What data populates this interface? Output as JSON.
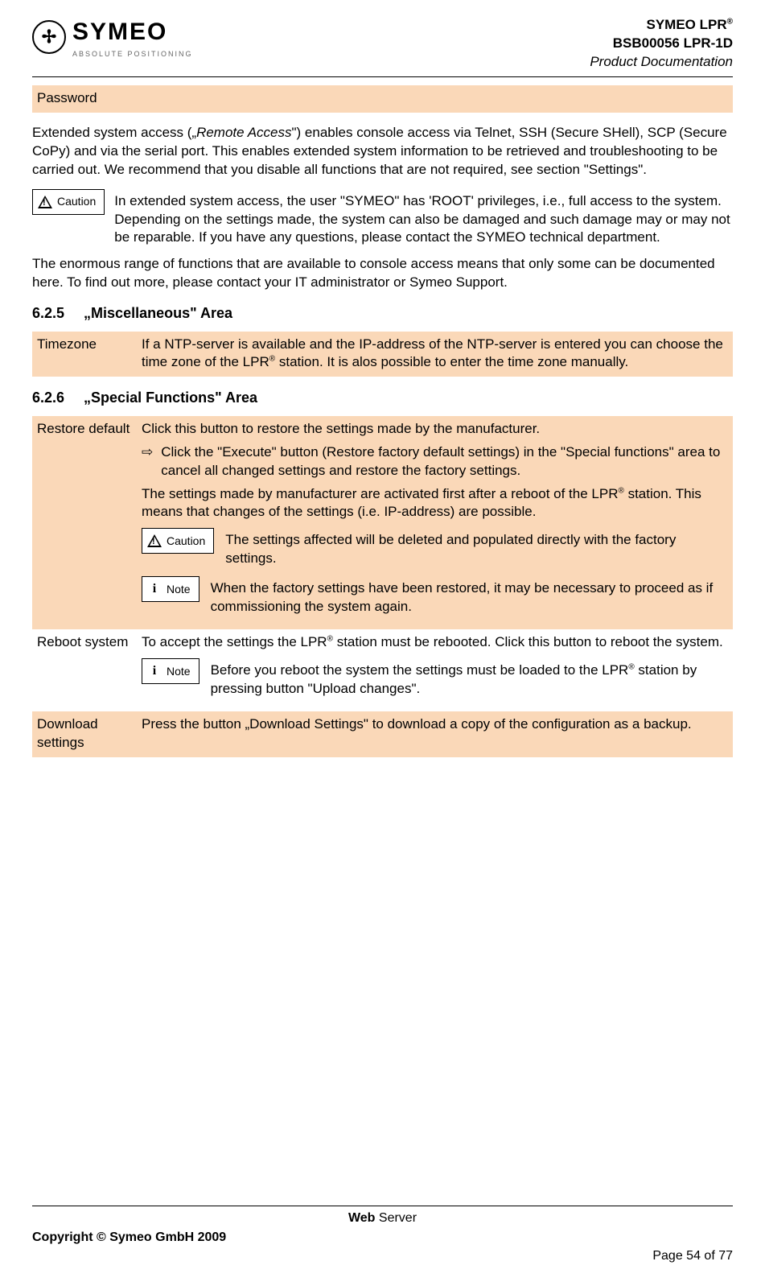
{
  "header": {
    "logo_name": "SYMEO",
    "logo_tag": "ABSOLUTE POSITIONING",
    "title1_pre": "SYMEO LPR",
    "title1_sup": "®",
    "title2": "BSB00056 LPR-1D",
    "title3": "Product Documentation"
  },
  "password_row": {
    "label": "Password",
    "value": ""
  },
  "para1_a": "Extended system access („",
  "para1_b": "Remote Access",
  "para1_c": "\") enables console access via Telnet, SSH (Secure SHell), SCP (Secure CoPy) and via the serial port. This enables extended system information to be retrieved and troubleshooting to be carried out. We recommend that you disable all functions that are not required, see section \"Settings\".",
  "caution_label": "Caution",
  "note_label": "Note",
  "caution1_text": "In extended system access, the user \"SYMEO\" has 'ROOT' privileges, i.e., full access to the system. Depending on the settings made, the system can also be damaged and such damage may or may not be reparable. If you have any questions, please contact the SYMEO technical department.",
  "para2": "The enormous range of functions that are available to console access means that only some can be documented here. To find out more, please contact your IT administrator or Symeo Support.",
  "sec625_no": "6.2.5",
  "sec625_title": "„Miscellaneous\" Area",
  "timezone": {
    "label": "Timezone",
    "text_a": "If a NTP-server is available and the IP-address of the NTP-server is entered you can choose the time zone of the LPR",
    "text_b": " station. It is alos possible to enter the time zone manually."
  },
  "sec626_no": "6.2.6",
  "sec626_title": "„Special Functions\" Area",
  "restore": {
    "label": "Restore default",
    "p1": "Click this button to restore the settings made by the manufacturer.",
    "bullet": "Click the \"Execute\" button (Restore factory default settings) in the \"Special functions\" area to cancel all changed settings and restore the factory settings.",
    "p2_a": "The settings made by manufacturer are activated first after a reboot of the LPR",
    "p2_b": " station. This means that changes of the settings (i.e. IP-address) are possible.",
    "caution_text": "The settings affected will be deleted and populated directly with the factory settings.",
    "note_text": "When the factory settings have been restored, it may be necessary to proceed as if commissioning the system again."
  },
  "reboot": {
    "label": "Reboot system",
    "p1_a": "To accept the settings the LPR",
    "p1_b": " station must be rebooted. Click this button to reboot the system.",
    "note_a": "Before you reboot the system the settings must be loaded to the LPR",
    "note_b": " station by pressing button \"Upload changes\"."
  },
  "download": {
    "label": "Download settings",
    "text": "Press the button „Download Settings\" to download a copy of the configuration as a backup."
  },
  "footer": {
    "section_b": "Web",
    "section_r": " Server",
    "copyright": "Copyright © Symeo GmbH 2009",
    "page": "Page 54 of 77"
  }
}
